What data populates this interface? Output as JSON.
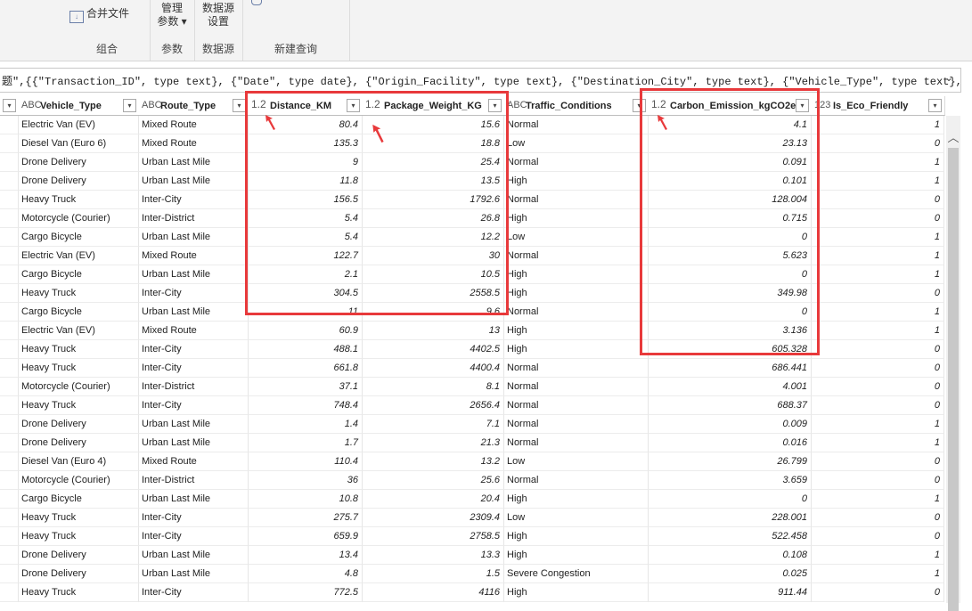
{
  "ribbon": {
    "groups": [
      {
        "label": "组合",
        "buttons": [
          "合并文件"
        ]
      },
      {
        "label": "参数",
        "buttons": [
          "管理",
          "参数 ▾"
        ]
      },
      {
        "label": "数据源",
        "buttons": [
          "数据源",
          "设置"
        ]
      },
      {
        "label": "新建查询",
        "buttons": []
      }
    ]
  },
  "formula": {
    "text": "题\",{{\"Transaction_ID\", type text}, {\"Date\", type date}, {\"Origin_Facility\", type text}, {\"Destination_City\", type text}, {\"Vehicle_Type\", type text},"
  },
  "columns": [
    {
      "name": "Vehicle_Type",
      "type_icon": "ABC"
    },
    {
      "name": "Route_Type",
      "type_icon": "ABC"
    },
    {
      "name": "Distance_KM",
      "type_icon": "1.2"
    },
    {
      "name": "Package_Weight_KG",
      "type_icon": "1.2"
    },
    {
      "name": "Traffic_Conditions",
      "type_icon": "ABC"
    },
    {
      "name": "Carbon_Emission_kgCO2e",
      "type_icon": "1.2"
    },
    {
      "name": "Is_Eco_Friendly",
      "type_icon": "123"
    }
  ],
  "rows": [
    [
      "Electric Van (EV)",
      "Mixed Route",
      "80.4",
      "15.6",
      "Normal",
      "4.1",
      "1"
    ],
    [
      "Diesel Van (Euro 6)",
      "Mixed Route",
      "135.3",
      "18.8",
      "Low",
      "23.13",
      "0"
    ],
    [
      "Drone Delivery",
      "Urban Last Mile",
      "9",
      "25.4",
      "Normal",
      "0.091",
      "1"
    ],
    [
      "Drone Delivery",
      "Urban Last Mile",
      "11.8",
      "13.5",
      "High",
      "0.101",
      "1"
    ],
    [
      "Heavy Truck",
      "Inter-City",
      "156.5",
      "1792.6",
      "Normal",
      "128.004",
      "0"
    ],
    [
      "Motorcycle (Courier)",
      "Inter-District",
      "5.4",
      "26.8",
      "High",
      "0.715",
      "0"
    ],
    [
      "Cargo Bicycle",
      "Urban Last Mile",
      "5.4",
      "12.2",
      "Low",
      "0",
      "1"
    ],
    [
      "Electric Van (EV)",
      "Mixed Route",
      "122.7",
      "30",
      "Normal",
      "5.623",
      "1"
    ],
    [
      "Cargo Bicycle",
      "Urban Last Mile",
      "2.1",
      "10.5",
      "High",
      "0",
      "1"
    ],
    [
      "Heavy Truck",
      "Inter-City",
      "304.5",
      "2558.5",
      "High",
      "349.98",
      "0"
    ],
    [
      "Cargo Bicycle",
      "Urban Last Mile",
      "11",
      "9.6",
      "Normal",
      "0",
      "1"
    ],
    [
      "Electric Van (EV)",
      "Mixed Route",
      "60.9",
      "13",
      "High",
      "3.136",
      "1"
    ],
    [
      "Heavy Truck",
      "Inter-City",
      "488.1",
      "4402.5",
      "High",
      "605.328",
      "0"
    ],
    [
      "Heavy Truck",
      "Inter-City",
      "661.8",
      "4400.4",
      "Normal",
      "686.441",
      "0"
    ],
    [
      "Motorcycle (Courier)",
      "Inter-District",
      "37.1",
      "8.1",
      "Normal",
      "4.001",
      "0"
    ],
    [
      "Heavy Truck",
      "Inter-City",
      "748.4",
      "2656.4",
      "Normal",
      "688.37",
      "0"
    ],
    [
      "Drone Delivery",
      "Urban Last Mile",
      "1.4",
      "7.1",
      "Normal",
      "0.009",
      "1"
    ],
    [
      "Drone Delivery",
      "Urban Last Mile",
      "1.7",
      "21.3",
      "Normal",
      "0.016",
      "1"
    ],
    [
      "Diesel Van (Euro 4)",
      "Mixed Route",
      "110.4",
      "13.2",
      "Low",
      "26.799",
      "0"
    ],
    [
      "Motorcycle (Courier)",
      "Inter-District",
      "36",
      "25.6",
      "Normal",
      "3.659",
      "0"
    ],
    [
      "Cargo Bicycle",
      "Urban Last Mile",
      "10.8",
      "20.4",
      "High",
      "0",
      "1"
    ],
    [
      "Heavy Truck",
      "Inter-City",
      "275.7",
      "2309.4",
      "Low",
      "228.001",
      "0"
    ],
    [
      "Heavy Truck",
      "Inter-City",
      "659.9",
      "2758.5",
      "High",
      "522.458",
      "0"
    ],
    [
      "Drone Delivery",
      "Urban Last Mile",
      "13.4",
      "13.3",
      "High",
      "0.108",
      "1"
    ],
    [
      "Drone Delivery",
      "Urban Last Mile",
      "4.8",
      "1.5",
      "Severe Congestion",
      "0.025",
      "1"
    ],
    [
      "Heavy Truck",
      "Inter-City",
      "772.5",
      "4116",
      "High",
      "911.44",
      "0"
    ]
  ],
  "colors": {
    "highlight": "#e8393b"
  }
}
